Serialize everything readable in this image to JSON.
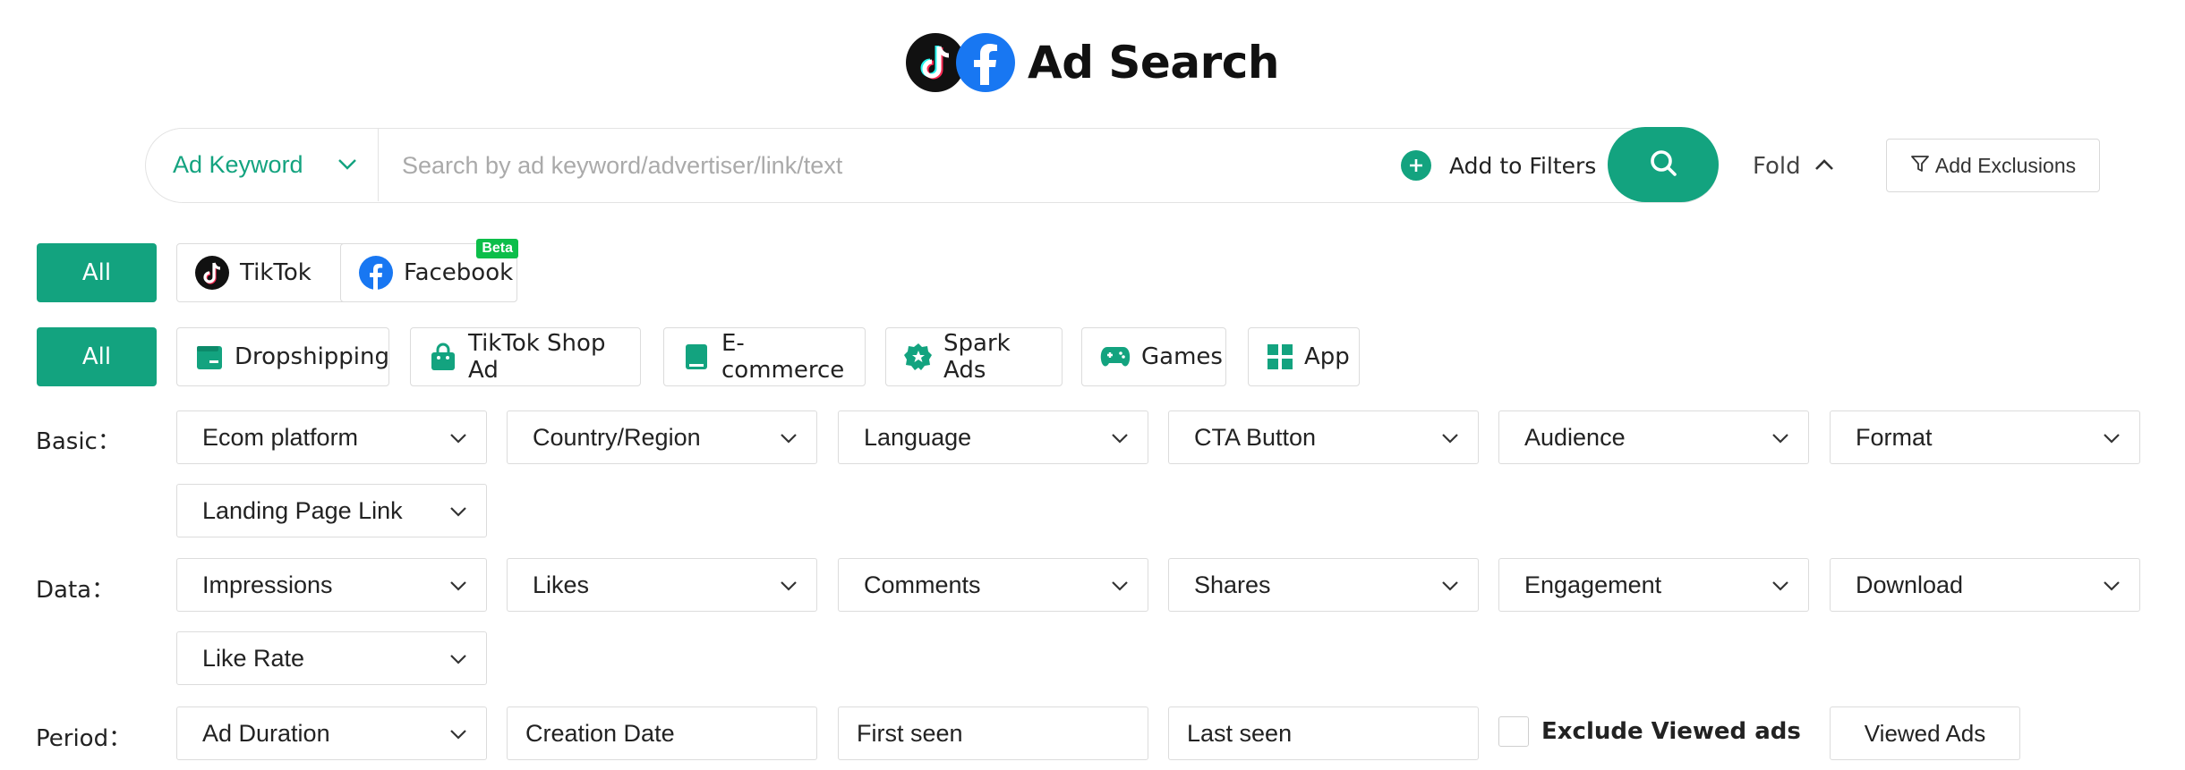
{
  "header": {
    "title": "Ad Search",
    "logos": [
      "tiktok-logo",
      "facebook-logo"
    ]
  },
  "search": {
    "mode_label": "Ad Keyword",
    "placeholder": "Search by ad keyword/advertiser/link/text",
    "value": "",
    "add_filters_label": "Add to Filters",
    "fold_label": "Fold",
    "exclusions_label": "Add Exclusions"
  },
  "platforms": {
    "all_label": "All",
    "items": [
      {
        "label": "TikTok",
        "icon": "tiktok-icon"
      },
      {
        "label": "Facebook",
        "icon": "facebook-icon",
        "badge": "Beta"
      }
    ]
  },
  "categories": {
    "all_label": "All",
    "items": [
      {
        "label": "Dropshipping",
        "icon": "wallet-icon"
      },
      {
        "label": "TikTok Shop Ad",
        "icon": "shopping-bag-icon"
      },
      {
        "label": "E-commerce",
        "icon": "bookmark-icon"
      },
      {
        "label": "Spark Ads",
        "icon": "badge-star-icon"
      },
      {
        "label": "Games",
        "icon": "gamepad-icon"
      },
      {
        "label": "App",
        "icon": "grid-icon"
      }
    ]
  },
  "filters": {
    "basic": {
      "label": "Basic：",
      "items": [
        "Ecom platform",
        "Country/Region",
        "Language",
        "CTA Button",
        "Audience",
        "Format",
        "Landing Page Link"
      ]
    },
    "data": {
      "label": "Data：",
      "items": [
        "Impressions",
        "Likes",
        "Comments",
        "Shares",
        "Engagement",
        "Download",
        "Like Rate"
      ]
    },
    "period": {
      "label": "Period：",
      "ad_duration": "Ad Duration",
      "creation_date": "Creation Date",
      "first_seen": "First seen",
      "last_seen": "Last seen",
      "exclude_viewed": "Exclude Viewed ads",
      "viewed_ads": "Viewed Ads"
    }
  },
  "colors": {
    "accent": "#13a37f",
    "facebook": "#1877f2",
    "beta": "#0dbe4a"
  }
}
